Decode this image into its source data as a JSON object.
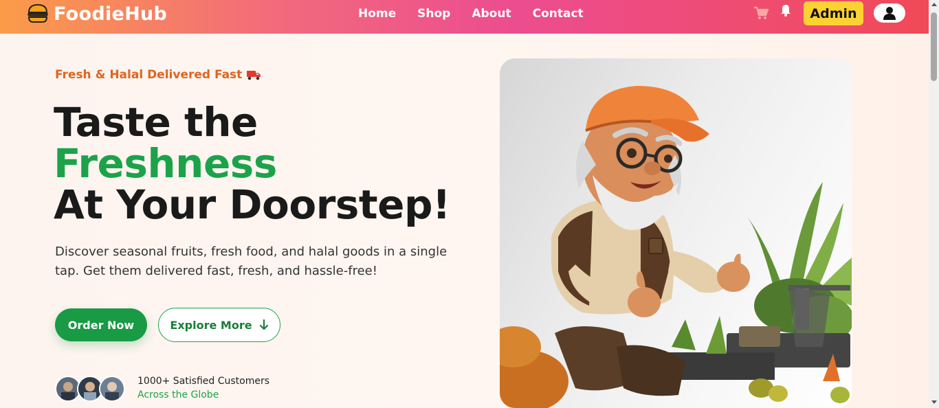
{
  "brand": {
    "name": "FoodieHub",
    "icon": "burger-icon"
  },
  "nav": {
    "links": [
      "Home",
      "Shop",
      "About",
      "Contact"
    ],
    "cart_icon": "cart-icon",
    "bell_icon": "bell-icon",
    "admin_label": "Admin",
    "user_icon": "user-icon"
  },
  "hero": {
    "tagline": "Fresh & Halal Delivered Fast",
    "headline_line1": "Taste the",
    "headline_line2": "Freshness",
    "headline_line3": "At Your Doorstep!",
    "description": "Discover seasonal fruits, fresh food, and halal goods in a single tap. Get them delivered fast, fresh, and hassle-free!",
    "order_label": "Order Now",
    "explore_label": "Explore More",
    "customers_count": "1000+ Satisfied Customers",
    "customers_sub": "Across the Globe"
  },
  "colors": {
    "accent_green": "#1ca34a",
    "tagline_orange": "#e0641f",
    "admin_yellow": "#fcd233"
  }
}
